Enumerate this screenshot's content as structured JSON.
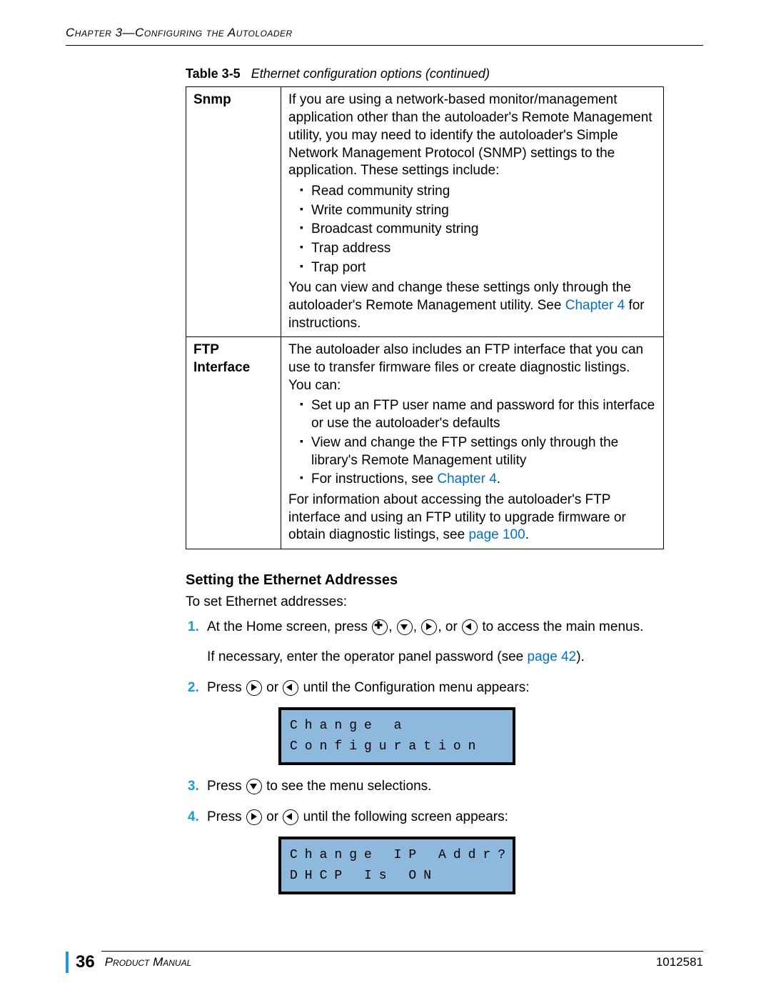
{
  "header": {
    "chapter": "Chapter 3—Configuring the Autoloader"
  },
  "tableCaption": {
    "label": "Table 3-5",
    "text": "Ethernet configuration options  (continued)"
  },
  "table": {
    "rows": [
      {
        "label": "Snmp",
        "intro": "If you are using a network-based monitor/management application other than the autoloader's Remote Management utility, you may need to identify the autoloader's Simple Network Management Protocol (SNMP) settings to the application. These settings include:",
        "bullets": [
          "Read community string",
          "Write community string",
          "Broadcast community string",
          "Trap address",
          "Trap port"
        ],
        "outro1": "You can view and change these settings only through the autoloader's Remote Management utility. See ",
        "outroLink": "Chapter 4",
        "outro2": " for instructions."
      },
      {
        "label": "FTP Interface",
        "intro": "The autoloader also includes an FTP interface that you can use to transfer firmware files or create diagnostic listings. You can:",
        "bullets": [
          "Set up an FTP user name and password for this interface or use the autoloader's defaults",
          "View and change the FTP settings only through the library's Remote Management utility"
        ],
        "bullet3a": "For instructions, see ",
        "bullet3Link": "Chapter 4",
        "bullet3b": ".",
        "outro1": "For information about accessing the autoloader's FTP interface and using an FTP utility to upgrade firmware or obtain diagnostic listings, see ",
        "outroLink": "page 100",
        "outro2": "."
      }
    ]
  },
  "section": {
    "heading": "Setting the Ethernet Addresses",
    "intro": "To set Ethernet addresses:"
  },
  "steps": [
    {
      "pre": "At the Home screen, press ",
      "mid": ", ",
      "or": ", or ",
      "post": " to access the main menus.",
      "note1": "If necessary, enter the operator panel password (see ",
      "noteLink": "page 42",
      "note2": ")."
    },
    {
      "pre": "Press ",
      "or": " or ",
      "post": " until the Configuration menu appears:"
    },
    {
      "pre": "Press ",
      "post": " to see the menu selections."
    },
    {
      "pre": "Press ",
      "or": " or ",
      "post": " until the following screen appears:"
    }
  ],
  "lcd": [
    {
      "line1": "Change a",
      "line2": "Configuration"
    },
    {
      "line1": "Change IP Addr?",
      "line2": "DHCP Is ON"
    }
  ],
  "footer": {
    "page": "36",
    "manual": "Product Manual",
    "docnum": "1012581"
  }
}
